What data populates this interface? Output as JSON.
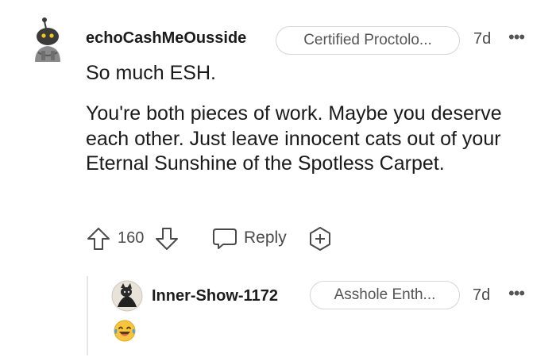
{
  "comment": {
    "username": "echoCashMeOusside",
    "flair": "Certified Proctolo...",
    "time": "7d",
    "more": "•••",
    "body_line1": "So much ESH.",
    "body_paragraph": "You're both pieces of work. Maybe you deserve each other. Just leave innocent cats out of your Eternal Sunshine of the Spotless Carpet.",
    "votes": "160",
    "reply_label": "Reply"
  },
  "reply": {
    "username": "Inner-Show-1172",
    "flair": "Asshole Enth...",
    "time": "7d",
    "more": "•••"
  },
  "icons": {
    "avatar1": "snoo-avatar-icon",
    "upvote": "upvote-arrow-icon",
    "downvote": "downvote-arrow-icon",
    "reply": "speech-bubble-icon",
    "award": "award-plus-icon",
    "avatar2": "user-avatar-icon",
    "emoji": "laughing-tears-emoji-icon"
  },
  "colors": {
    "text": "#1a1a1b",
    "muted": "#4a4a4a",
    "border": "#d6d6d6",
    "emoji_yellow": "#f7c53b"
  }
}
